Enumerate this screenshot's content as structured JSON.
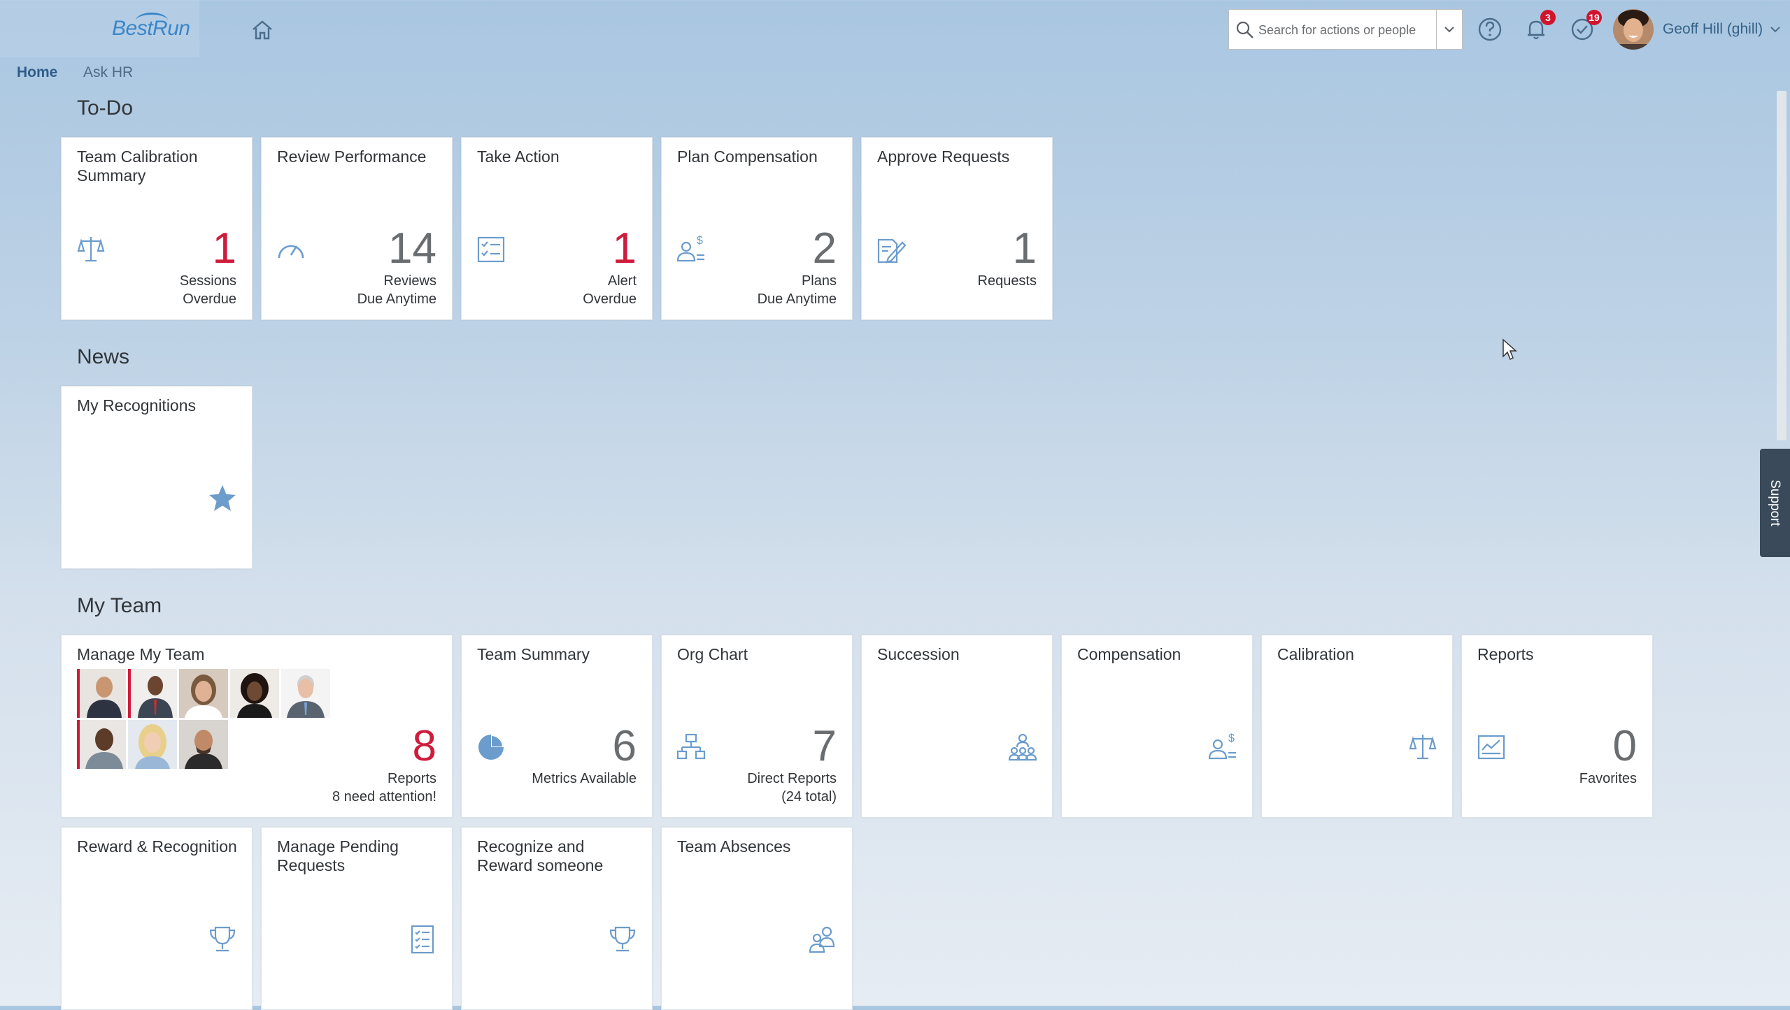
{
  "header": {
    "logo_text": "BestRun",
    "search_placeholder": "Search for actions or people",
    "notifications_count": "3",
    "todo_count": "19",
    "user_name": "Geoff Hill (ghill)"
  },
  "nav": {
    "home": "Home",
    "ask_hr": "Ask HR"
  },
  "todo": {
    "title": "To-Do",
    "tiles": [
      {
        "title": "Team Calibration Summary",
        "number": "1",
        "sub": "Sessions\nOverdue",
        "icon": "scale-icon"
      },
      {
        "title": "Review Performance",
        "number": "14",
        "sub": "Reviews\nDue Anytime",
        "icon": "gauge-icon"
      },
      {
        "title": "Take Action",
        "number": "1",
        "sub": "Alert\nOverdue",
        "icon": "checklist-icon"
      },
      {
        "title": "Plan Compensation",
        "number": "2",
        "sub": "Plans\nDue Anytime",
        "icon": "person-dollar-icon"
      },
      {
        "title": "Approve Requests",
        "number": "1",
        "sub": "Requests",
        "icon": "document-pen-icon"
      }
    ]
  },
  "news": {
    "title": "News",
    "tiles": [
      {
        "title": "My Recognitions",
        "icon": "star-icon"
      }
    ]
  },
  "team": {
    "title": "My Team",
    "manage": {
      "title": "Manage My Team",
      "number": "8",
      "sub": "Reports\n8 need attention!"
    },
    "tiles": [
      {
        "title": "Team Summary",
        "number": "6",
        "sub": "Metrics Available",
        "icon": "pie-chart-icon"
      },
      {
        "title": "Org Chart",
        "number": "7",
        "sub": "Direct Reports\n(24 total)",
        "icon": "org-chart-icon"
      },
      {
        "title": "Succession",
        "icon": "people-group-icon"
      },
      {
        "title": "Compensation",
        "icon": "person-dollar-icon"
      },
      {
        "title": "Calibration",
        "icon": "scale-icon"
      },
      {
        "title": "Reports",
        "number": "0",
        "sub": "Favorites",
        "icon": "report-icon"
      },
      {
        "title": "Reward & Recognition",
        "icon": "trophy-icon"
      },
      {
        "title": "Manage Pending Requests",
        "icon": "request-list-icon"
      },
      {
        "title": "Recognize and Reward someone",
        "icon": "trophy-icon"
      },
      {
        "title": "Team Absences",
        "icon": "people-icon"
      }
    ]
  },
  "support_label": "Support",
  "colors": {
    "accent": "#346187",
    "alert": "#cf1b3c",
    "icon": "#6b9ccc"
  }
}
